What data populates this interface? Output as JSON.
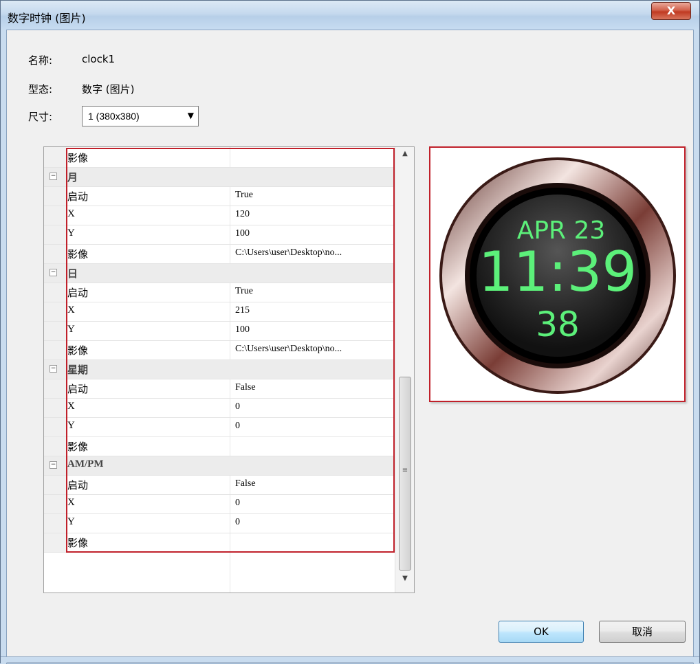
{
  "window": {
    "title": "数字时钟 (图片)",
    "close_label": "X"
  },
  "info": {
    "name_label": "名称:",
    "name_value": "clock1",
    "type_label": "型态:",
    "type_value": "数字 (图片)",
    "size_label": "尺寸:",
    "size_value": "1  (380x380)"
  },
  "grid": {
    "rows": [
      {
        "kind": "prop",
        "name": "影像",
        "value": ""
      },
      {
        "kind": "cat",
        "name": "月"
      },
      {
        "kind": "prop",
        "name": "启动",
        "value": "True"
      },
      {
        "kind": "prop",
        "name": "X",
        "value": "120"
      },
      {
        "kind": "prop",
        "name": "Y",
        "value": "100"
      },
      {
        "kind": "prop",
        "name": "影像",
        "value": "C:\\Users\\user\\Desktop\\no..."
      },
      {
        "kind": "cat",
        "name": "日"
      },
      {
        "kind": "prop",
        "name": "启动",
        "value": "True"
      },
      {
        "kind": "prop",
        "name": "X",
        "value": "215"
      },
      {
        "kind": "prop",
        "name": "Y",
        "value": "100"
      },
      {
        "kind": "prop",
        "name": "影像",
        "value": "C:\\Users\\user\\Desktop\\no..."
      },
      {
        "kind": "cat",
        "name": "星期"
      },
      {
        "kind": "prop",
        "name": "启动",
        "value": "False"
      },
      {
        "kind": "prop",
        "name": "X",
        "value": "0"
      },
      {
        "kind": "prop",
        "name": "Y",
        "value": "0"
      },
      {
        "kind": "prop",
        "name": "影像",
        "value": ""
      },
      {
        "kind": "cat",
        "name": "AM/PM"
      },
      {
        "kind": "prop",
        "name": "启动",
        "value": "False"
      },
      {
        "kind": "prop",
        "name": "X",
        "value": "0"
      },
      {
        "kind": "prop",
        "name": "Y",
        "value": "0"
      },
      {
        "kind": "prop",
        "name": "影像",
        "value": ""
      }
    ],
    "expander_symbol": "−",
    "scroll_up_icon": "▲",
    "scroll_down_icon": "▼",
    "scroll_grip_icon": "≡"
  },
  "preview": {
    "date_text": "APR 23",
    "time_text": "11:39",
    "seconds_text": "38",
    "digit_color": "#5cf07a"
  },
  "buttons": {
    "ok": "OK",
    "cancel": "取消"
  }
}
